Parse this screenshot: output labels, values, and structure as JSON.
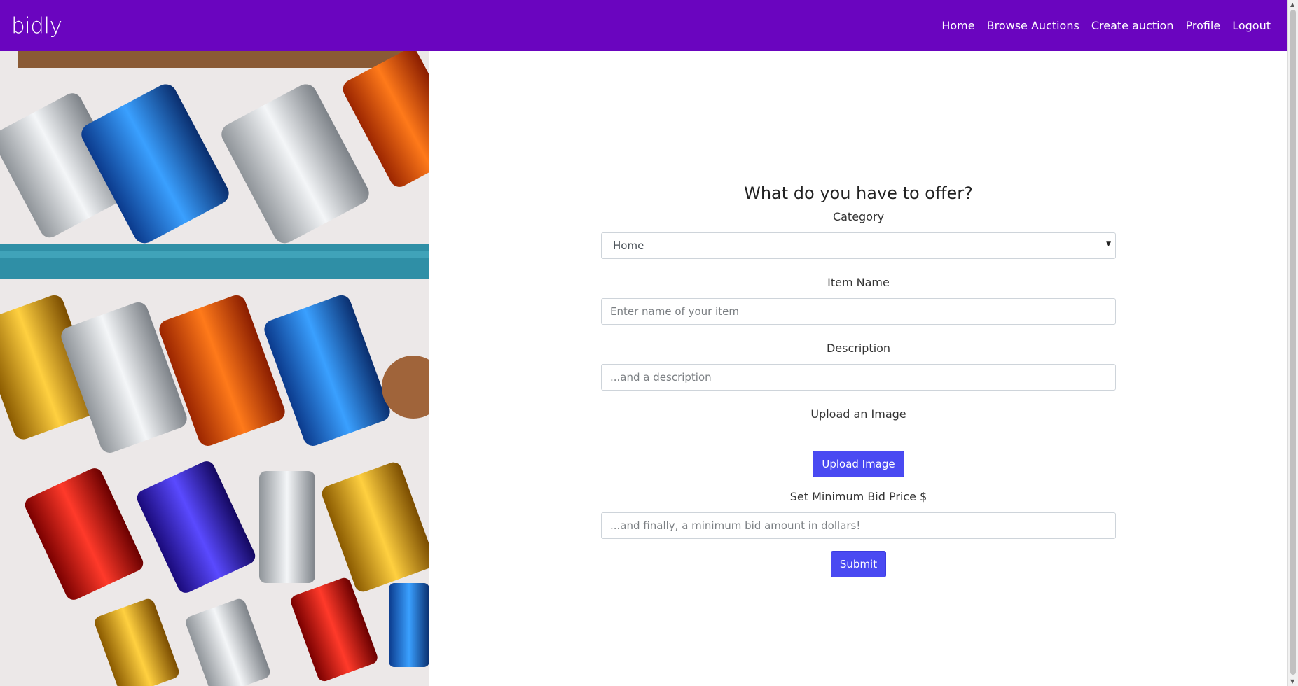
{
  "nav": {
    "brand": "bidly",
    "links": [
      "Home",
      "Browse Auctions",
      "Create auction",
      "Profile",
      "Logout"
    ]
  },
  "form": {
    "title": "What do you have to offer?",
    "category_label": "Category",
    "category_value": "Home",
    "item_name_label": "Item Name",
    "item_name_placeholder": "Enter name of your item",
    "description_label": "Description",
    "description_placeholder": "...and a description",
    "upload_label": "Upload an Image",
    "upload_button": "Upload Image",
    "min_bid_label": "Set Minimum Bid Price $",
    "min_bid_placeholder": "...and finally, a minimum bid amount in dollars!",
    "submit_button": "Submit"
  },
  "colors": {
    "navbar": "#6a05bf",
    "button": "#4a4af2"
  },
  "icons": {
    "select_caret": "caret-down-icon",
    "scroll_up": "scroll-up-icon",
    "scroll_down": "scroll-down-icon"
  }
}
